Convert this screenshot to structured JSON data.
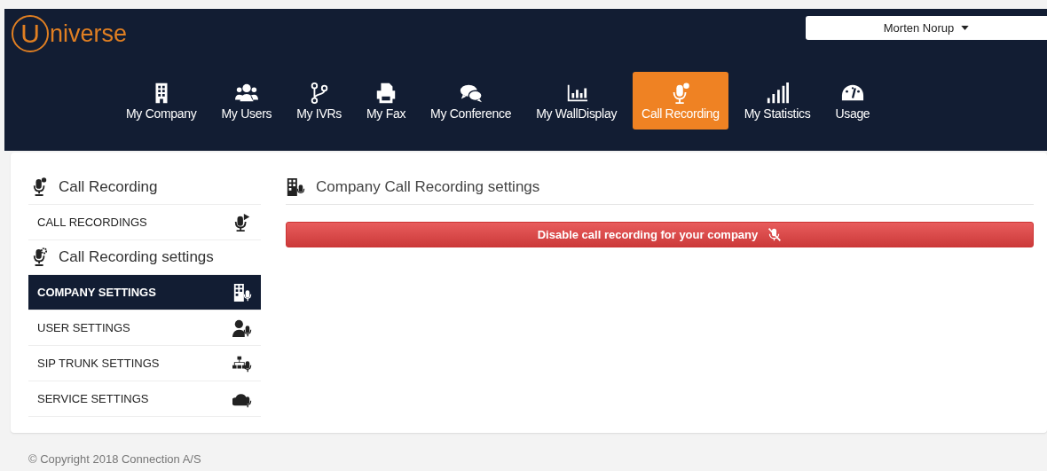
{
  "logo": {
    "letter": "U",
    "rest": "niverse"
  },
  "user_menu": {
    "label": "Morten Norup"
  },
  "nav": [
    {
      "label": "My Company",
      "kind": "building",
      "selected": false
    },
    {
      "label": "My Users",
      "kind": "users",
      "selected": false
    },
    {
      "label": "My IVRs",
      "kind": "branch",
      "selected": false
    },
    {
      "label": "My Fax",
      "kind": "printer",
      "selected": false
    },
    {
      "label": "My Conference",
      "kind": "chat",
      "selected": false
    },
    {
      "label": "My WallDisplay",
      "kind": "barchart",
      "selected": false
    },
    {
      "label": "Call Recording",
      "kind": "mic",
      "selected": true
    },
    {
      "label": "My Statistics",
      "kind": "signal",
      "selected": false
    },
    {
      "label": "Usage",
      "kind": "gauge",
      "selected": false
    }
  ],
  "sidebar": {
    "sections": [
      {
        "title": "Call Recording",
        "kind": "mic",
        "items": [
          {
            "label": "CALL RECORDINGS",
            "kind": "micplay",
            "selected": false
          }
        ]
      },
      {
        "title": "Call Recording settings",
        "kind": "micgear",
        "items": [
          {
            "label": "COMPANY SETTINGS",
            "kind": "building",
            "selected": true
          },
          {
            "label": "USER SETTINGS",
            "kind": "user",
            "selected": false
          },
          {
            "label": "SIP TRUNK SETTINGS",
            "kind": "network",
            "selected": false
          },
          {
            "label": "SERVICE SETTINGS",
            "kind": "cloud",
            "selected": false
          }
        ]
      }
    ]
  },
  "main": {
    "title": "Company Call Recording settings",
    "button": "Disable call recording for your company"
  },
  "footer": "© Copyright 2018 Connection A/S"
}
